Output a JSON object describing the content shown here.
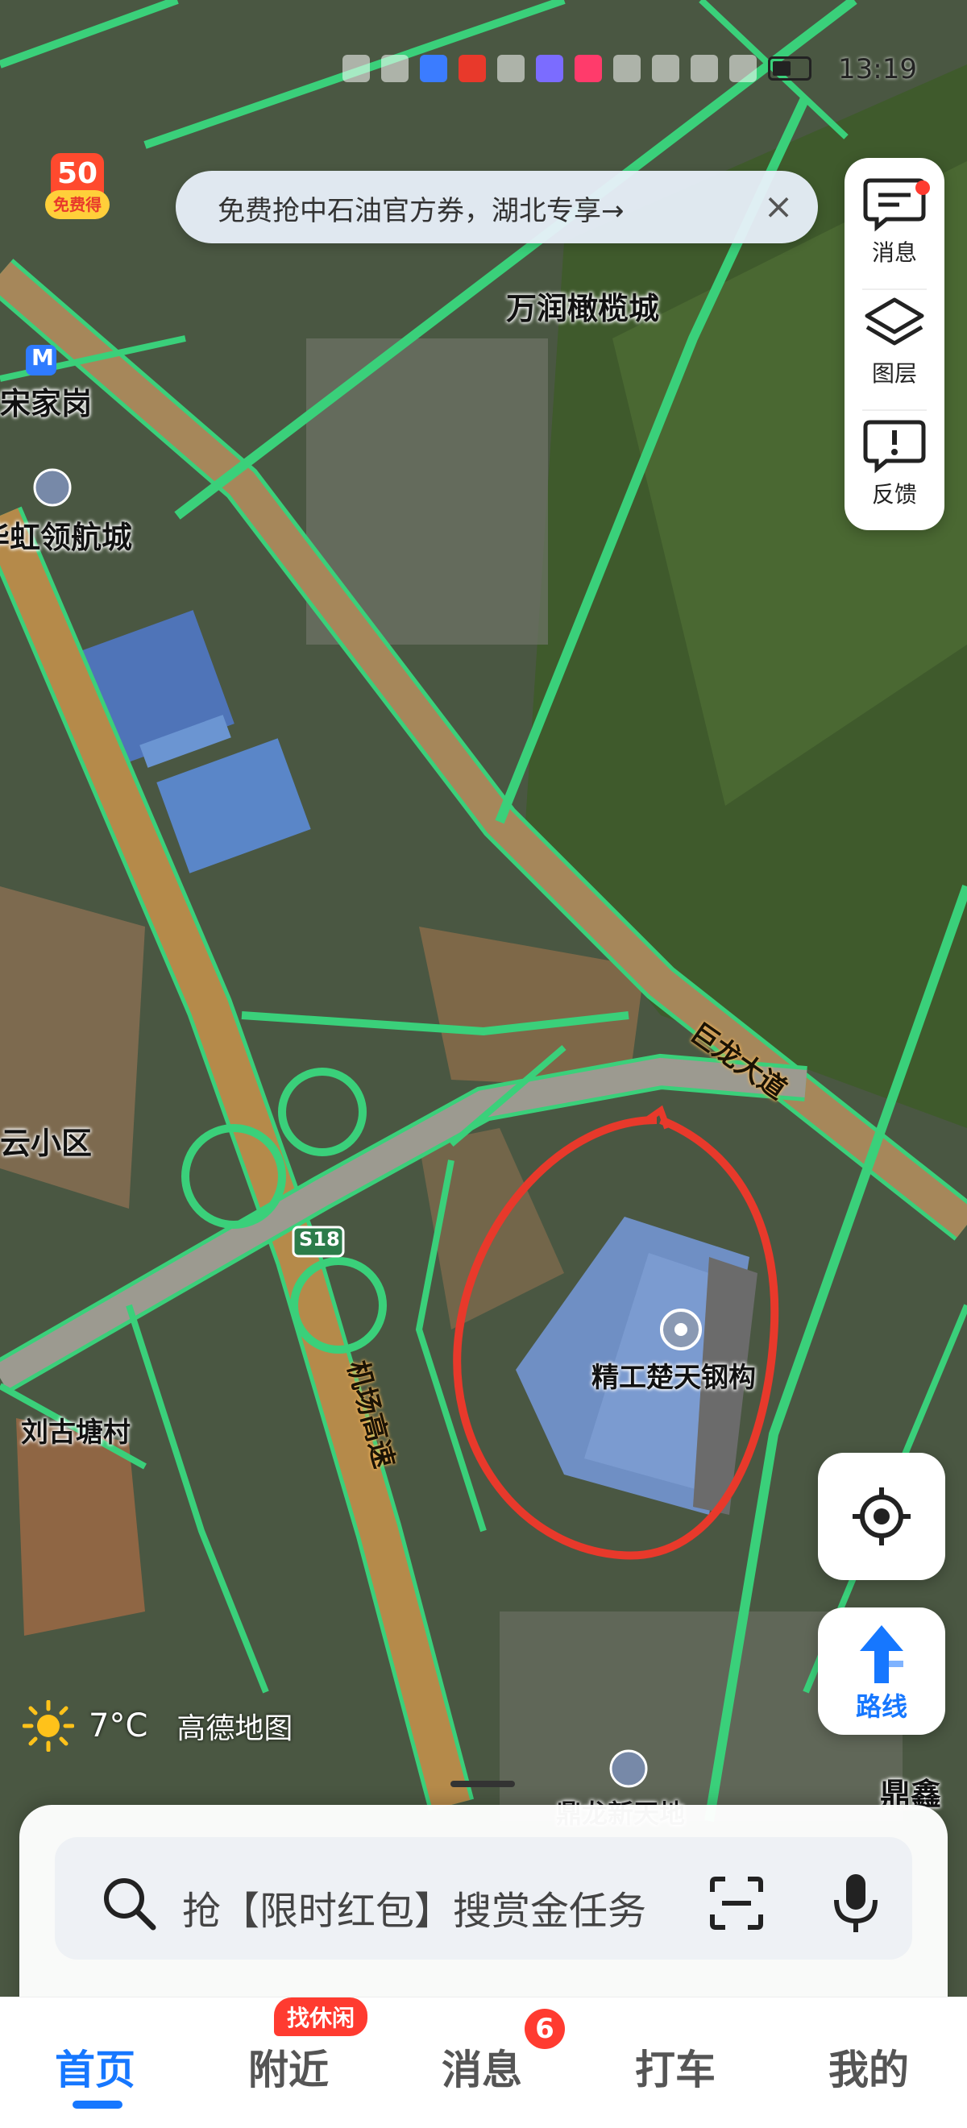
{
  "status_bar": {
    "time": "13:19"
  },
  "promo_badge": {
    "number": "50",
    "caption": "免费得"
  },
  "banner": {
    "text": "免费抢中石油官方券，湖北专享→",
    "close": "×"
  },
  "tools": [
    {
      "label": "消息",
      "icon": "message-icon",
      "has_dot": true
    },
    {
      "label": "图层",
      "icon": "layers-icon"
    },
    {
      "label": "反馈",
      "icon": "feedback-icon"
    }
  ],
  "map": {
    "poi_labels": {
      "wanrun": "万润橄榄城",
      "songjiagang": "宋家岗",
      "linghangcheng": "华虹领航城",
      "yunxiaoqu": "云小区",
      "liugutang": "刘古塘村",
      "jinggong": "精工楚天钢构",
      "dingxin": "鼎鑫",
      "bottom_cut": "鼎龙新天地"
    },
    "road_labels": {
      "julong": "巨龙大道",
      "airport": "机场高速",
      "shield": "S18"
    },
    "metro_letter": "M",
    "accent": "#1677ff",
    "annotation_color": "#e8392b",
    "road_outline_color": "#3ad07a"
  },
  "route_button": {
    "label": "路线"
  },
  "weather": {
    "temp": "7°C",
    "brand": "高德地图"
  },
  "search": {
    "placeholder": "抢【限时红包】搜赏金任务"
  },
  "nav": {
    "items": [
      "首页",
      "附近",
      "消息",
      "打车",
      "我的"
    ],
    "nearby_tag": "找休闲",
    "message_badge": "6"
  }
}
